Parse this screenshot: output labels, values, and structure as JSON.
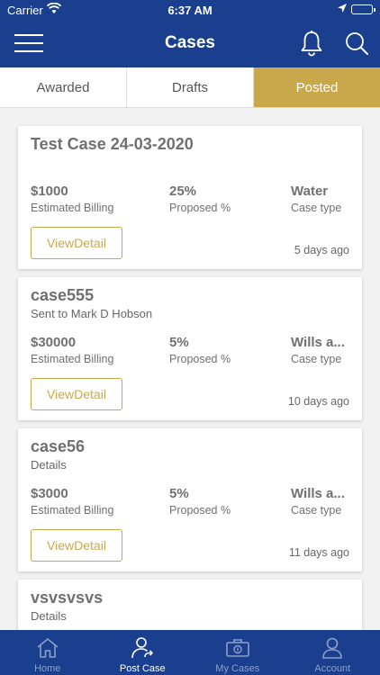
{
  "status": {
    "carrier": "Carrier",
    "time": "6:37 AM"
  },
  "header": {
    "title": "Cases"
  },
  "tabs": [
    {
      "label": "Awarded",
      "active": false
    },
    {
      "label": "Drafts",
      "active": false
    },
    {
      "label": "Posted",
      "active": true
    }
  ],
  "cases": [
    {
      "title": "Test Case 24-03-2020",
      "subtitle": "",
      "billing_value": "$1000",
      "billing_label": "Estimated Billing",
      "proposed_value": "25%",
      "proposed_label": "Proposed %",
      "type_value": "Water",
      "type_label": "Case type",
      "button": "ViewDetail",
      "age": "5 days ago"
    },
    {
      "title": "case555",
      "subtitle": "Sent to Mark D Hobson",
      "billing_value": "$30000",
      "billing_label": "Estimated Billing",
      "proposed_value": "5%",
      "proposed_label": "Proposed %",
      "type_value": "Wills a...",
      "type_label": "Case type",
      "button": "ViewDetail",
      "age": "10 days ago"
    },
    {
      "title": "case56",
      "subtitle": "Details",
      "billing_value": "$3000",
      "billing_label": "Estimated Billing",
      "proposed_value": "5%",
      "proposed_label": "Proposed %",
      "type_value": "Wills a...",
      "type_label": "Case type",
      "button": "ViewDetail",
      "age": "11 days ago"
    },
    {
      "title": "vsvsvsvs",
      "subtitle": "Details"
    }
  ],
  "bottom_nav": [
    {
      "label": "Home",
      "icon": "home-icon",
      "active": false
    },
    {
      "label": "Post Case",
      "icon": "post-case-icon",
      "active": true
    },
    {
      "label": "My Cases",
      "icon": "my-cases-icon",
      "active": false
    },
    {
      "label": "Account",
      "icon": "account-icon",
      "active": false
    }
  ],
  "colors": {
    "primary": "#1b3f8f",
    "accent": "#c9a84c",
    "background": "#f2f2f2"
  }
}
